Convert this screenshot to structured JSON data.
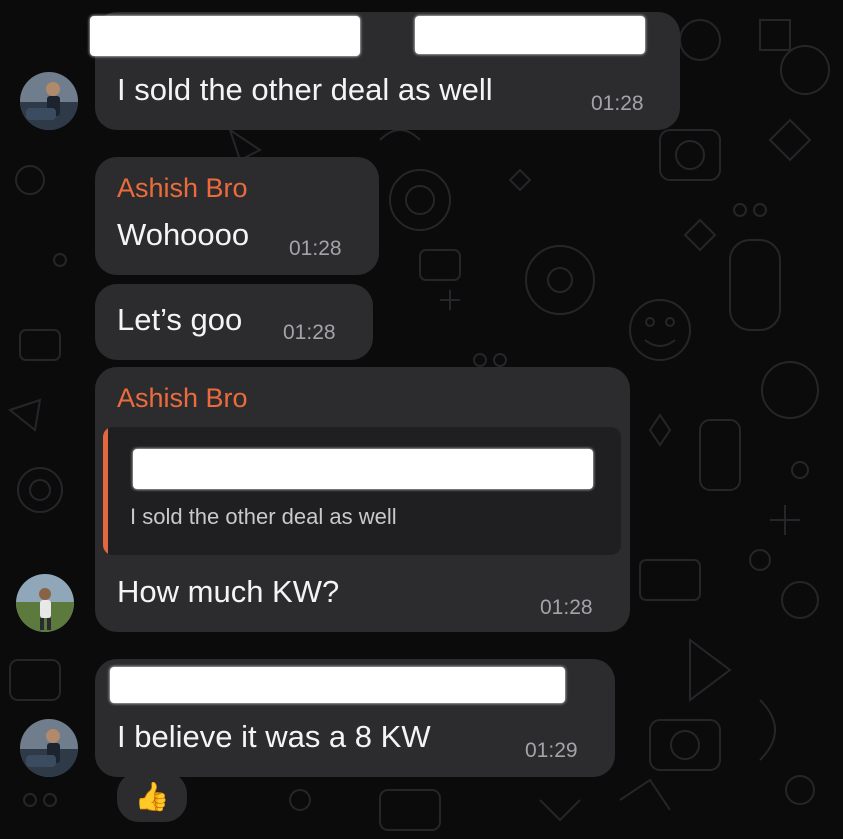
{
  "messages": [
    {
      "id": "m1",
      "text": "I sold the other deal as well",
      "time": "01:28"
    },
    {
      "id": "m2",
      "sender": "Ashish Bro",
      "text": "Wohoooo",
      "time": "01:28"
    },
    {
      "id": "m3",
      "text": "Let’s goo",
      "time": "01:28"
    },
    {
      "id": "m4",
      "sender": "Ashish Bro",
      "quoted_text": "I sold the other deal as well",
      "text": "How much KW?",
      "time": "01:28"
    },
    {
      "id": "m5",
      "text": "I believe it was a 8 KW",
      "time": "01:29",
      "reaction": "👍"
    }
  ],
  "colors": {
    "sender_name": "#ec6b3c",
    "bubble": "#2c2c2e",
    "background": "#0b0b0c"
  }
}
